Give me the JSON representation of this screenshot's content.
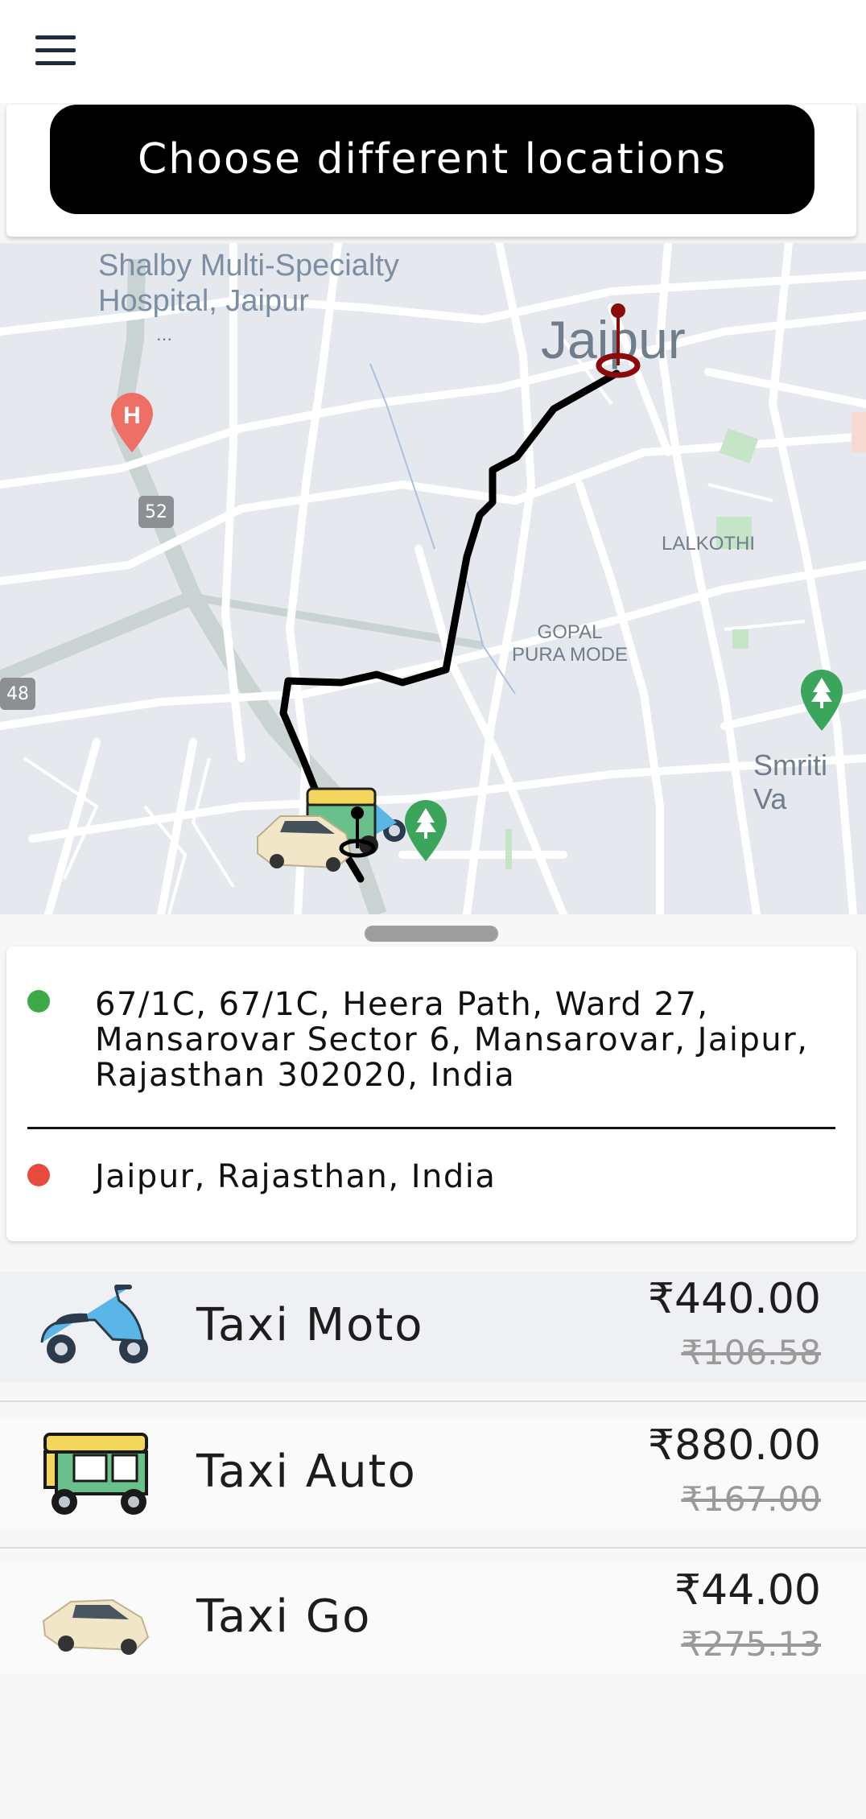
{
  "header": {
    "choose_label": "Choose different locations"
  },
  "map": {
    "labels": {
      "hospital_line1": "Shalby Multi-Specialty",
      "hospital_line2": "Hospital, Jaipur",
      "hospital_dots": "...",
      "city": "Jaipur",
      "lalkothi": "LALKOTHI",
      "gopal_line1": "GOPAL",
      "gopal_line2": "PURA MODE",
      "smriti": "Smriti Va",
      "road_52": "52",
      "road_48": "48",
      "hospital_marker": "H"
    }
  },
  "route": {
    "pickup": {
      "line1": "67/1C, 67/1C, Heera Path, Ward 27,",
      "line2": "Mansarovar Sector 6, Mansarovar, Jaipur,",
      "line3": "Rajasthan 302020, India",
      "color": "#3daa4a"
    },
    "dropoff": {
      "text": "Jaipur, Rajasthan, India",
      "color": "#e84a3c"
    }
  },
  "rides": [
    {
      "name": "Taxi Moto",
      "price": "₹440.00",
      "old_price": "₹106.58",
      "icon": "scooter-icon"
    },
    {
      "name": "Taxi Auto",
      "price": "₹880.00",
      "old_price": "₹167.00",
      "icon": "auto-rickshaw-icon"
    },
    {
      "name": "Taxi Go",
      "price": "₹44.00",
      "old_price": "₹275.13",
      "icon": "car-icon"
    }
  ],
  "colors": {
    "accent": "#000000",
    "selected_row": "#eef0f3",
    "route_line": "#000000",
    "destination_pin": "#8b0a0a"
  }
}
